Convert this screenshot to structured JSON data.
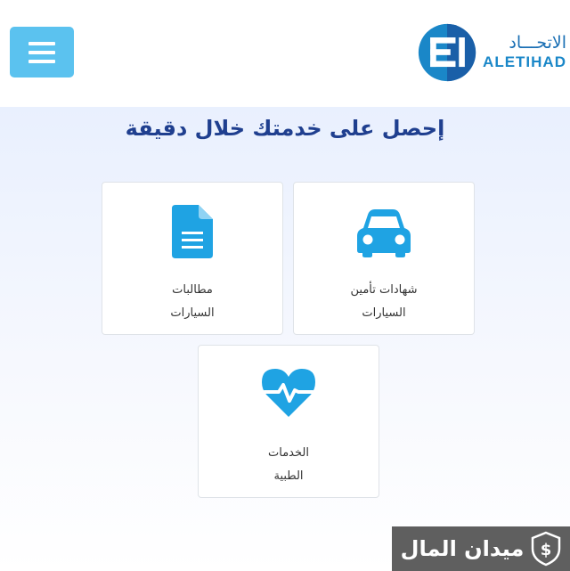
{
  "header": {
    "logo": {
      "arabic": "الاتحـــاد",
      "english": "ALETIHAD",
      "colors": {
        "primary": "#1a6fb4",
        "accent": "#1a87c8"
      }
    },
    "menu_icon": "hamburger-icon",
    "menu_color": "#5bc2ef"
  },
  "main": {
    "title": "إحصل على خدمتك خلال دقيقة",
    "cards": [
      {
        "icon": "car-icon",
        "line1": "شهادات تأمين",
        "line2": "السيارات"
      },
      {
        "icon": "document-icon",
        "line1": "مطالبات",
        "line2": "السيارات"
      },
      {
        "icon": "heart-pulse-icon",
        "line1": "الخدمات",
        "line2": "الطبية"
      }
    ],
    "icon_color": "#1fa3e3"
  },
  "watermark": {
    "text": "ميدان المال",
    "icon": "money-shield-icon"
  }
}
